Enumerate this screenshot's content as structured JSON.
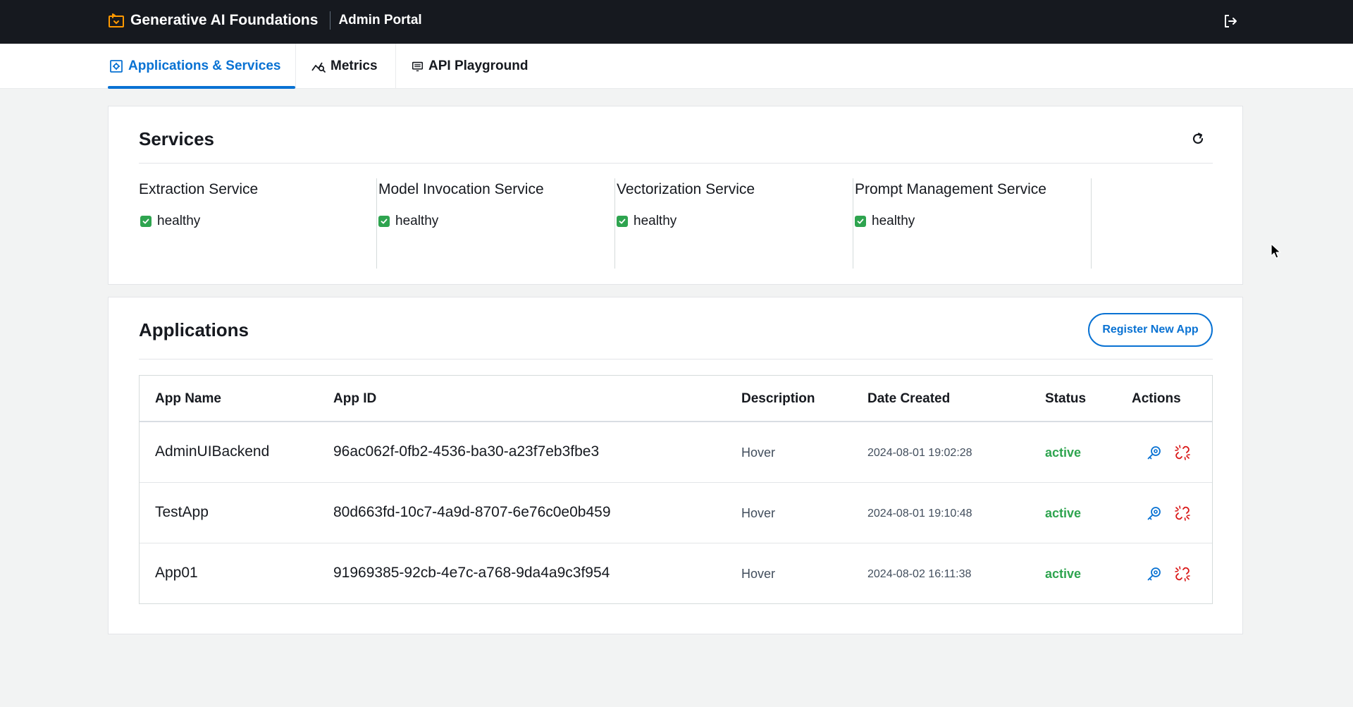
{
  "header": {
    "brand_title": "Generative AI Foundations",
    "brand_subtitle": "Admin Portal"
  },
  "tabs": [
    {
      "label": "Applications & Services",
      "icon": "settings-icon",
      "active": true
    },
    {
      "label": "Metrics",
      "icon": "chart-icon",
      "active": false
    },
    {
      "label": "API Playground",
      "icon": "monitor-icon",
      "active": false
    }
  ],
  "services": {
    "title": "Services",
    "items": [
      {
        "name": "Extraction Service",
        "status": "healthy"
      },
      {
        "name": "Model Invocation Service",
        "status": "healthy"
      },
      {
        "name": "Vectorization Service",
        "status": "healthy"
      },
      {
        "name": "Prompt Management Service",
        "status": "healthy"
      }
    ]
  },
  "applications": {
    "title": "Applications",
    "register_button": "Register New App",
    "columns": [
      "App Name",
      "App ID",
      "Description",
      "Date Created",
      "Status",
      "Actions"
    ],
    "rows": [
      {
        "name": "AdminUIBackend",
        "id": "96ac062f-0fb2-4536-ba30-a23f7eb3fbe3",
        "description": "Hover",
        "date": "2024-08-01 19:02:28",
        "status": "active"
      },
      {
        "name": "TestApp",
        "id": "80d663fd-10c7-4a9d-8707-6e76c0e0b459",
        "description": "Hover",
        "date": "2024-08-01 19:10:48",
        "status": "active"
      },
      {
        "name": "App01",
        "id": "91969385-92cb-4e7c-a768-9da4a9c3f954",
        "description": "Hover",
        "date": "2024-08-02 16:11:38",
        "status": "active"
      }
    ]
  },
  "colors": {
    "topbar": "#16191f",
    "accent": "#0972d3",
    "logo": "#ff9900",
    "healthy": "#2ea44f",
    "danger": "#d91515"
  }
}
